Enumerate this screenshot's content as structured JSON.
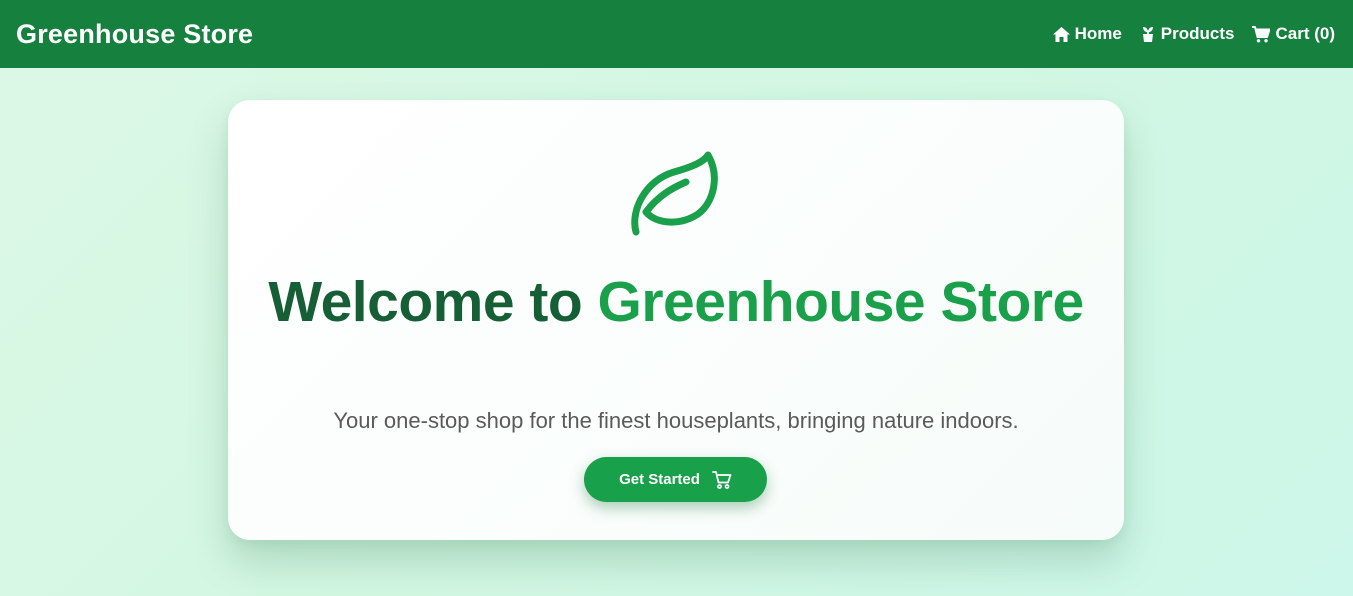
{
  "navbar": {
    "brand": "Greenhouse Store",
    "links": [
      {
        "label": "Home",
        "icon": "home-icon"
      },
      {
        "label": "Products",
        "icon": "plant-icon"
      },
      {
        "label": "Cart (0)",
        "icon": "cart-icon"
      }
    ]
  },
  "hero": {
    "icon": "leaf-icon",
    "title_part1": "Welcome to ",
    "title_part2": "Greenhouse Store",
    "subtitle": "Your one-stop shop for the finest houseplants, bringing nature indoors.",
    "cta_label": "Get Started",
    "cta_icon": "cart-icon"
  },
  "colors": {
    "navbar_bg": "#16803f",
    "accent": "#1aa04b",
    "title_dark": "#165e35",
    "page_bg": "#d2f7e2"
  }
}
